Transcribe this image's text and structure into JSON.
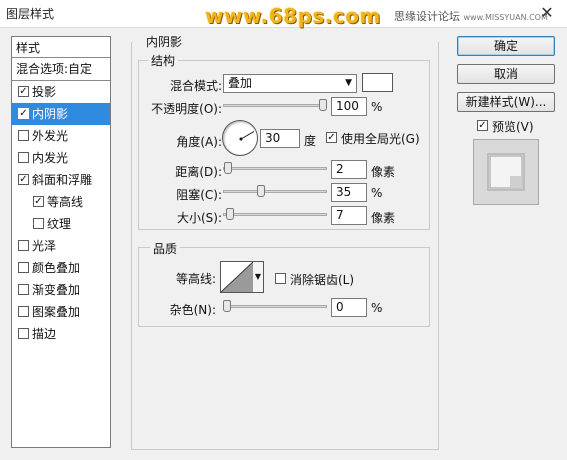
{
  "window": {
    "title": "图层样式",
    "watermark": "www.68ps.com",
    "site_credit": "思缘设计论坛",
    "site_credit_url": "www.MISSYUAN.COM",
    "close_glyph": "✕"
  },
  "sidebar": {
    "header": "样式",
    "blend_options": "混合选项:自定",
    "items": [
      {
        "label": "投影",
        "checked": true
      },
      {
        "label": "内阴影",
        "checked": true,
        "selected": true
      },
      {
        "label": "外发光",
        "checked": false
      },
      {
        "label": "内发光",
        "checked": false
      },
      {
        "label": "斜面和浮雕",
        "checked": true
      },
      {
        "label": "等高线",
        "checked": true,
        "sub": true
      },
      {
        "label": "纹理",
        "checked": false,
        "sub": true
      },
      {
        "label": "光泽",
        "checked": false
      },
      {
        "label": "颜色叠加",
        "checked": false
      },
      {
        "label": "渐变叠加",
        "checked": false
      },
      {
        "label": "图案叠加",
        "checked": false
      },
      {
        "label": "描边",
        "checked": false
      }
    ]
  },
  "panel": {
    "title": "内阴影",
    "structure": {
      "title": "结构",
      "blend_mode_label": "混合模式:",
      "blend_mode_value": "叠加",
      "blend_color": "#ffffff",
      "opacity_label": "不透明度(O):",
      "opacity_value": "100",
      "opacity_unit": "%",
      "angle_label": "角度(A):",
      "angle_value": "30",
      "angle_unit": "度",
      "global_light_label": "使用全局光(G)",
      "global_light_checked": true,
      "distance_label": "距离(D):",
      "distance_value": "2",
      "distance_unit": "像素",
      "choke_label": "阻塞(C):",
      "choke_value": "35",
      "choke_unit": "%",
      "size_label": "大小(S):",
      "size_value": "7",
      "size_unit": "像素"
    },
    "quality": {
      "title": "品质",
      "contour_label": "等高线:",
      "antialias_label": "消除锯齿(L)",
      "antialias_checked": false,
      "noise_label": "杂色(N):",
      "noise_value": "0",
      "noise_unit": "%"
    }
  },
  "buttons": {
    "ok": "确定",
    "cancel": "取消",
    "new_style": "新建样式(W)...",
    "preview_label": "预览(V)",
    "preview_checked": true
  }
}
